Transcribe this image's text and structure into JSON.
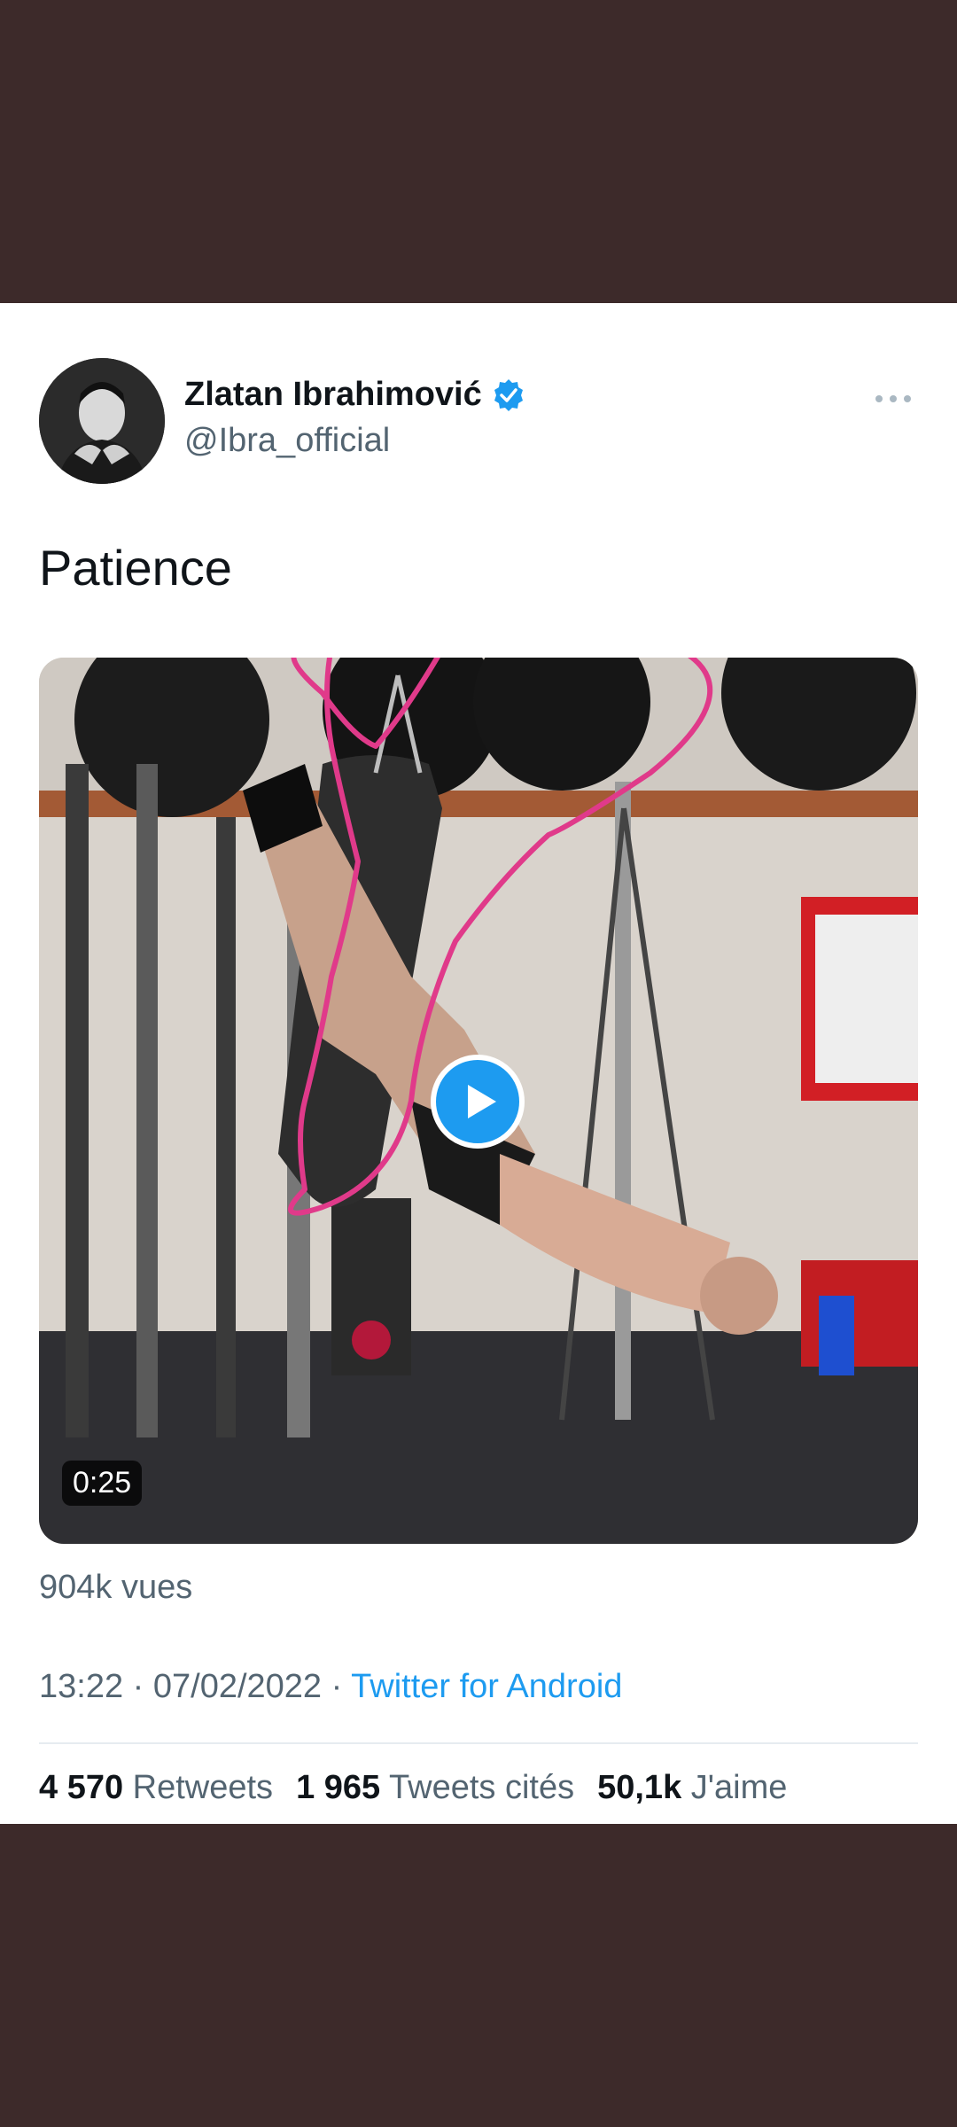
{
  "tweet": {
    "author_name": "Zlatan Ibrahimović",
    "handle": "@Ibra_official",
    "text": "Patience",
    "verified_icon": "verified-badge-icon",
    "more_icon": "more-options-icon"
  },
  "media": {
    "duration": "0:25",
    "play_icon": "play-icon"
  },
  "views": "904k vues",
  "meta": {
    "time": "13:22",
    "date": "07/02/2022",
    "separator": "·",
    "source": "Twitter for Android"
  },
  "stats": {
    "retweets_count": "4 570",
    "retweets_label": "Retweets",
    "quotes_count": "1 965",
    "quotes_label": "Tweets cités",
    "likes_count": "50,1k",
    "likes_label": "J'aime"
  },
  "colors": {
    "background": "#3d2a2a",
    "accent": "#1d9bf0",
    "highlight_outline": "#e03a8a"
  }
}
